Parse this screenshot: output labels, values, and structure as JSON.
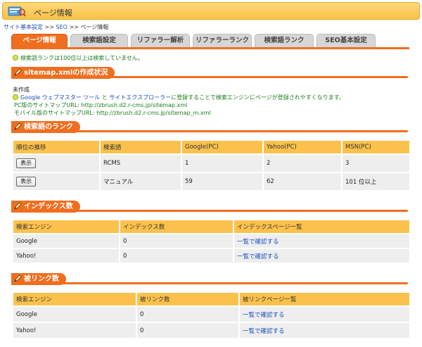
{
  "page": {
    "title": "ページ情報",
    "breadcrumb": [
      "サイト基本設定",
      "SEO",
      "ページ情報"
    ],
    "breadcrumb_sep": ">>"
  },
  "tabs": [
    "ページ情報",
    "検索語設定",
    "リファラー解析",
    "リファラーランク",
    "検索語ランク",
    "SEO基本設定"
  ],
  "active_tab": 0,
  "notice": "検索語ランクは100位以上は検索していません。",
  "sitemap": {
    "heading": "sitemap.xmlの作成状況",
    "status": "未作成",
    "desc_link1": "Google ウェブマスター ツール",
    "desc_and": "と",
    "desc_link2": "サイトエクスプローラー",
    "desc_rest": "に登録することで検索エンジンにページが登録されやすくなります。",
    "pc_label": "PC版のサイトマップURL:",
    "pc_url": "http://zbrush.d2.r-cms.jp/sitemap.xml",
    "mobile_label": "モバイル版のサイトマップURL:",
    "mobile_url": "http://zbrush.d2.r-cms.jp/sitemap_m.xml"
  },
  "rank": {
    "heading": "検索語のランク",
    "columns": [
      "順位の推移",
      "検索語",
      "Google(PC)",
      "Yahoo(PC)",
      "MSN(PC)"
    ],
    "button_label": "表示",
    "rows": [
      {
        "term": "RCMS",
        "google": "1",
        "yahoo": "2",
        "msn": "3"
      },
      {
        "term": "マニュアル",
        "google": "59",
        "yahoo": "62",
        "msn": "101 位以上"
      }
    ]
  },
  "index": {
    "heading": "インデックス数",
    "columns": [
      "検索エンジン",
      "インデックス数",
      "インデックスページ一覧"
    ],
    "rows": [
      {
        "engine": "Google",
        "count": "0",
        "link": "一覧で確認する"
      },
      {
        "engine": "Yahoo!",
        "count": "0",
        "link": "一覧で確認する"
      }
    ]
  },
  "backlinks": {
    "heading": "被リンク数",
    "columns": [
      "検索エンジン",
      "被リンク数",
      "被リンクページ一覧"
    ],
    "rows": [
      {
        "engine": "Google",
        "count": "0",
        "link": "一覧で確認する"
      },
      {
        "engine": "Yahoo!",
        "count": "0",
        "link": "一覧で確認する"
      }
    ]
  },
  "colors": {
    "accent": "#f06e1f",
    "header_bar": "#fcc14c",
    "row_bg": "#eeeeee",
    "link": "#1b4fb7",
    "notice": "#1a7c1a"
  },
  "icons": [
    "page-info-icon",
    "bulb-icon",
    "pencil-icon"
  ]
}
